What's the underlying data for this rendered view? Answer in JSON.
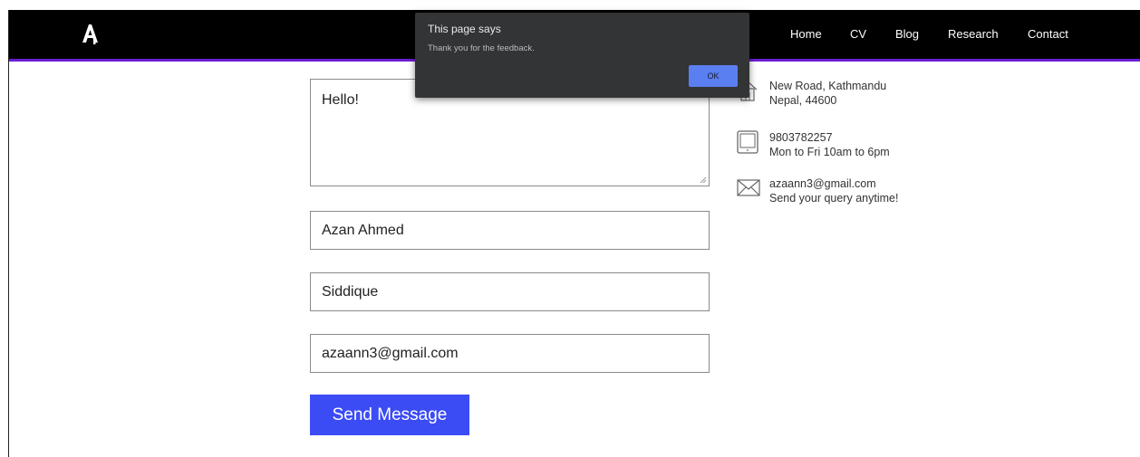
{
  "navbar": {
    "logo_icon": "letter-a-logo-icon",
    "links": [
      "Home",
      "CV",
      "Blog",
      "Research",
      "Contact"
    ],
    "accent_color": "#6a1fd1"
  },
  "form": {
    "message": "Hello!",
    "first_name": "Azan Ahmed",
    "last_name": "Siddique",
    "email": "azaann3@gmail.com",
    "submit_label": "Send Message",
    "button_color": "#3b4cf5"
  },
  "contact_info": {
    "address": {
      "icon": "home-icon",
      "line1": "New Road, Kathmandu",
      "line2": "Nepal, 44600"
    },
    "phone": {
      "icon": "tablet-icon",
      "line1": "9803782257",
      "line2": "Mon to Fri 10am to 6pm"
    },
    "email": {
      "icon": "envelope-icon",
      "line1": "azaann3@gmail.com",
      "line2": "Send your query anytime!"
    }
  },
  "dialog": {
    "title": "This page says",
    "message": "Thank you for the feedback.",
    "ok_label": "OK"
  }
}
